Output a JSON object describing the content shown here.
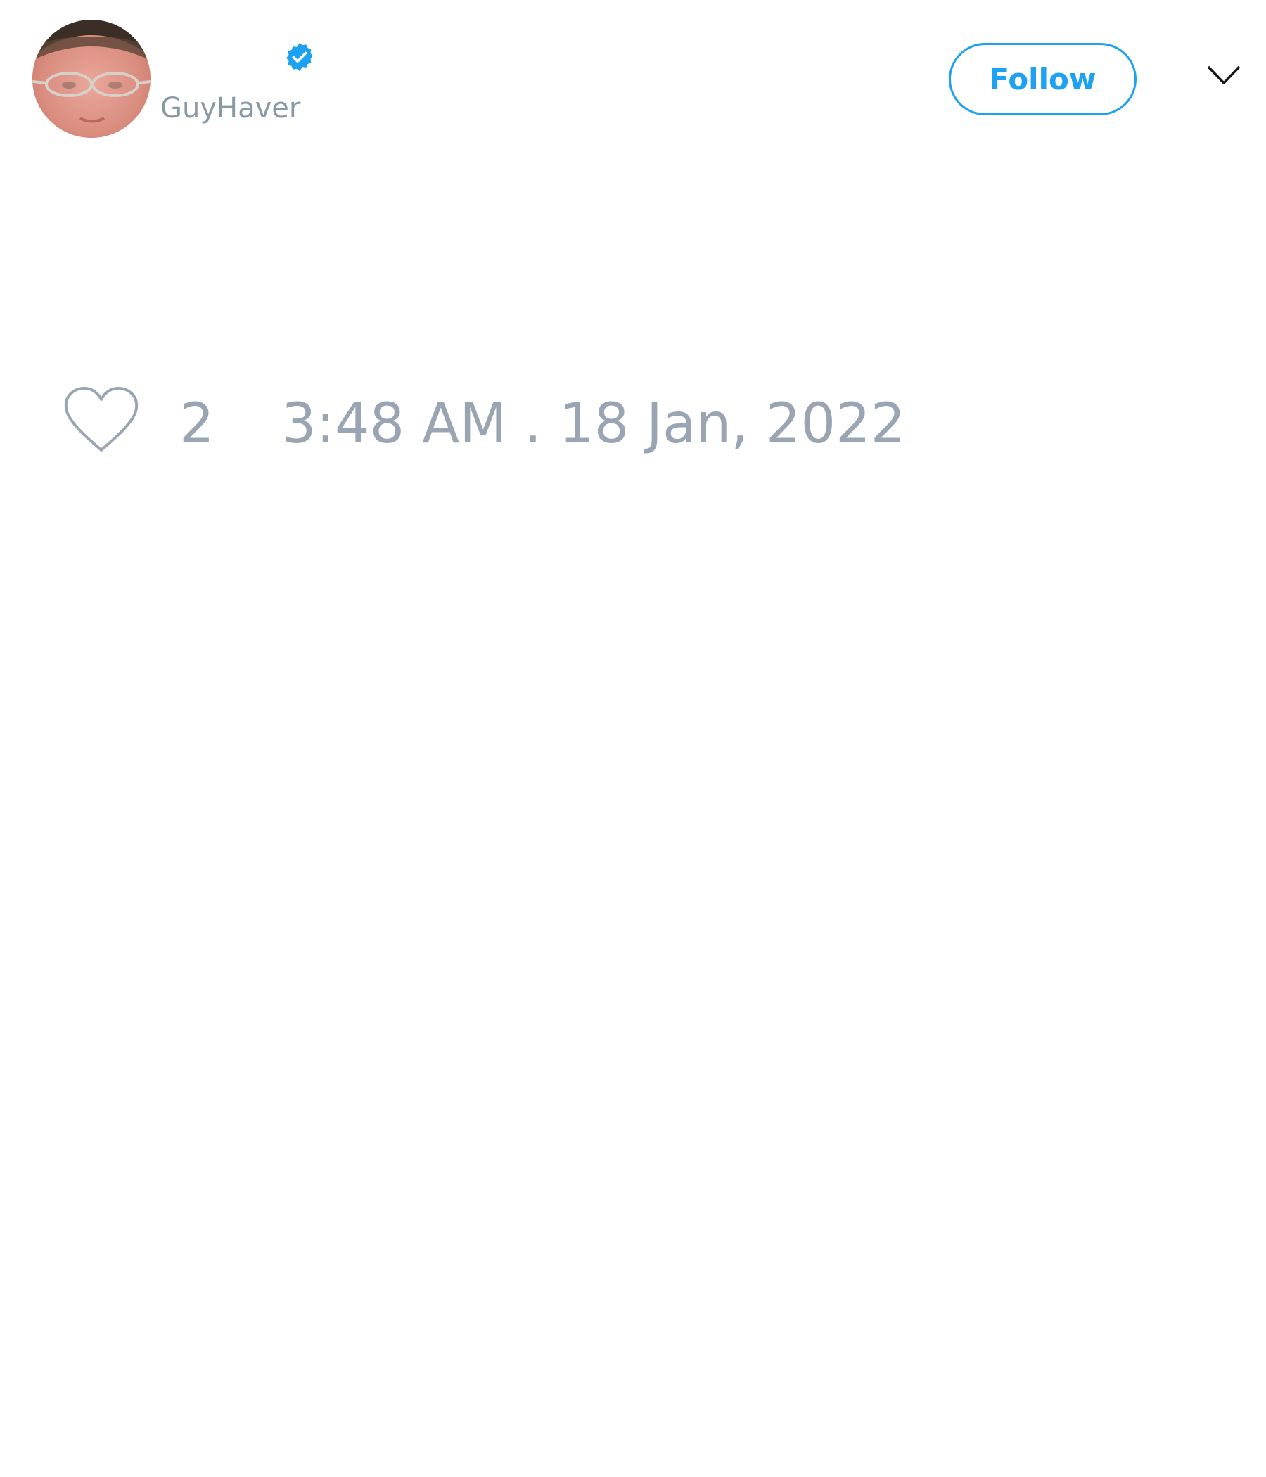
{
  "tweet": {
    "author": {
      "display_name": "",
      "handle": "GuyHaver",
      "verified": true,
      "avatar_icon": "profile-photo"
    },
    "follow_label": "Follow",
    "menu_icon": "chevron-down-icon",
    "like_icon": "heart-outline-icon",
    "like_count": "2",
    "timestamp": "3:48 AM . 18 Jan, 2022"
  },
  "colors": {
    "accent": "#1da1f2",
    "muted": "#9aa5b4",
    "handle": "#8899a6",
    "background": "#ffffff"
  }
}
